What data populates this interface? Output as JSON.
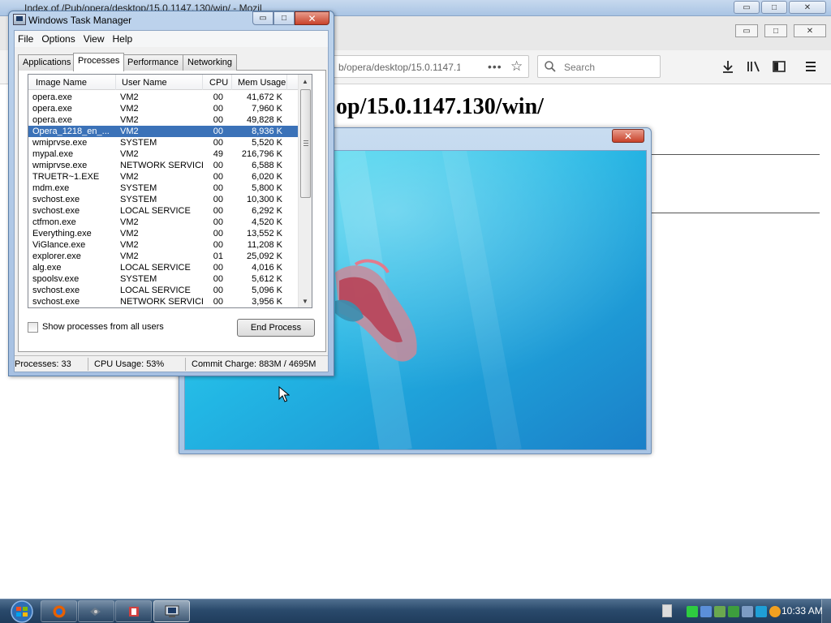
{
  "firefox": {
    "title": "Index of /Pub/opera/desktop/15.0.1147.130/win/ - Mozil",
    "url": "b/opera/desktop/15.0.1147.1",
    "url_more": "•••",
    "search_placeholder": "Search",
    "heading": "op/15.0.1147.130/win/",
    "outer_buttons": {
      "minimize": "▭",
      "maximize": "□",
      "close": "✕"
    },
    "inner_buttons": {
      "minimize": "▭",
      "maximize": "□",
      "close": "✕"
    }
  },
  "image_viewer": {
    "close_label": "✕"
  },
  "task_manager": {
    "title": "Windows Task Manager",
    "menu": [
      "File",
      "Options",
      "View",
      "Help"
    ],
    "tabs": [
      "Applications",
      "Processes",
      "Performance",
      "Networking"
    ],
    "active_tab": "Processes",
    "columns": [
      "Image Name",
      "User Name",
      "CPU",
      "Mem Usage"
    ],
    "processes": [
      {
        "name": "opera.exe",
        "user": "VM2",
        "cpu": "00",
        "mem": "41,672 K"
      },
      {
        "name": "opera.exe",
        "user": "VM2",
        "cpu": "00",
        "mem": "7,960 K"
      },
      {
        "name": "opera.exe",
        "user": "VM2",
        "cpu": "00",
        "mem": "49,828 K"
      },
      {
        "name": "Opera_1218_en_...",
        "user": "VM2",
        "cpu": "00",
        "mem": "8,936 K",
        "selected": true
      },
      {
        "name": "wmiprvse.exe",
        "user": "SYSTEM",
        "cpu": "00",
        "mem": "5,520 K"
      },
      {
        "name": "mypal.exe",
        "user": "VM2",
        "cpu": "49",
        "mem": "216,796 K"
      },
      {
        "name": "wmiprvse.exe",
        "user": "NETWORK SERVICE",
        "cpu": "00",
        "mem": "6,588 K"
      },
      {
        "name": "TRUETR~1.EXE",
        "user": "VM2",
        "cpu": "00",
        "mem": "6,020 K"
      },
      {
        "name": "mdm.exe",
        "user": "SYSTEM",
        "cpu": "00",
        "mem": "5,800 K"
      },
      {
        "name": "svchost.exe",
        "user": "SYSTEM",
        "cpu": "00",
        "mem": "10,300 K"
      },
      {
        "name": "svchost.exe",
        "user": "LOCAL SERVICE",
        "cpu": "00",
        "mem": "6,292 K"
      },
      {
        "name": "ctfmon.exe",
        "user": "VM2",
        "cpu": "00",
        "mem": "4,520 K"
      },
      {
        "name": "Everything.exe",
        "user": "VM2",
        "cpu": "00",
        "mem": "13,552 K"
      },
      {
        "name": "ViGlance.exe",
        "user": "VM2",
        "cpu": "00",
        "mem": "11,208 K"
      },
      {
        "name": "explorer.exe",
        "user": "VM2",
        "cpu": "01",
        "mem": "25,092 K"
      },
      {
        "name": "alg.exe",
        "user": "LOCAL SERVICE",
        "cpu": "00",
        "mem": "4,016 K"
      },
      {
        "name": "spoolsv.exe",
        "user": "SYSTEM",
        "cpu": "00",
        "mem": "5,612 K"
      },
      {
        "name": "svchost.exe",
        "user": "LOCAL SERVICE",
        "cpu": "00",
        "mem": "5,096 K"
      },
      {
        "name": "svchost.exe",
        "user": "NETWORK SERVICE",
        "cpu": "00",
        "mem": "3,956 K"
      }
    ],
    "show_all_label": "Show processes from all users",
    "end_process_label": "End Process",
    "status": {
      "processes": "Processes: 33",
      "cpu": "CPU Usage: 53%",
      "commit": "Commit Charge: 883M / 4695M"
    }
  },
  "taskbar": {
    "clock": "10:33 AM"
  }
}
